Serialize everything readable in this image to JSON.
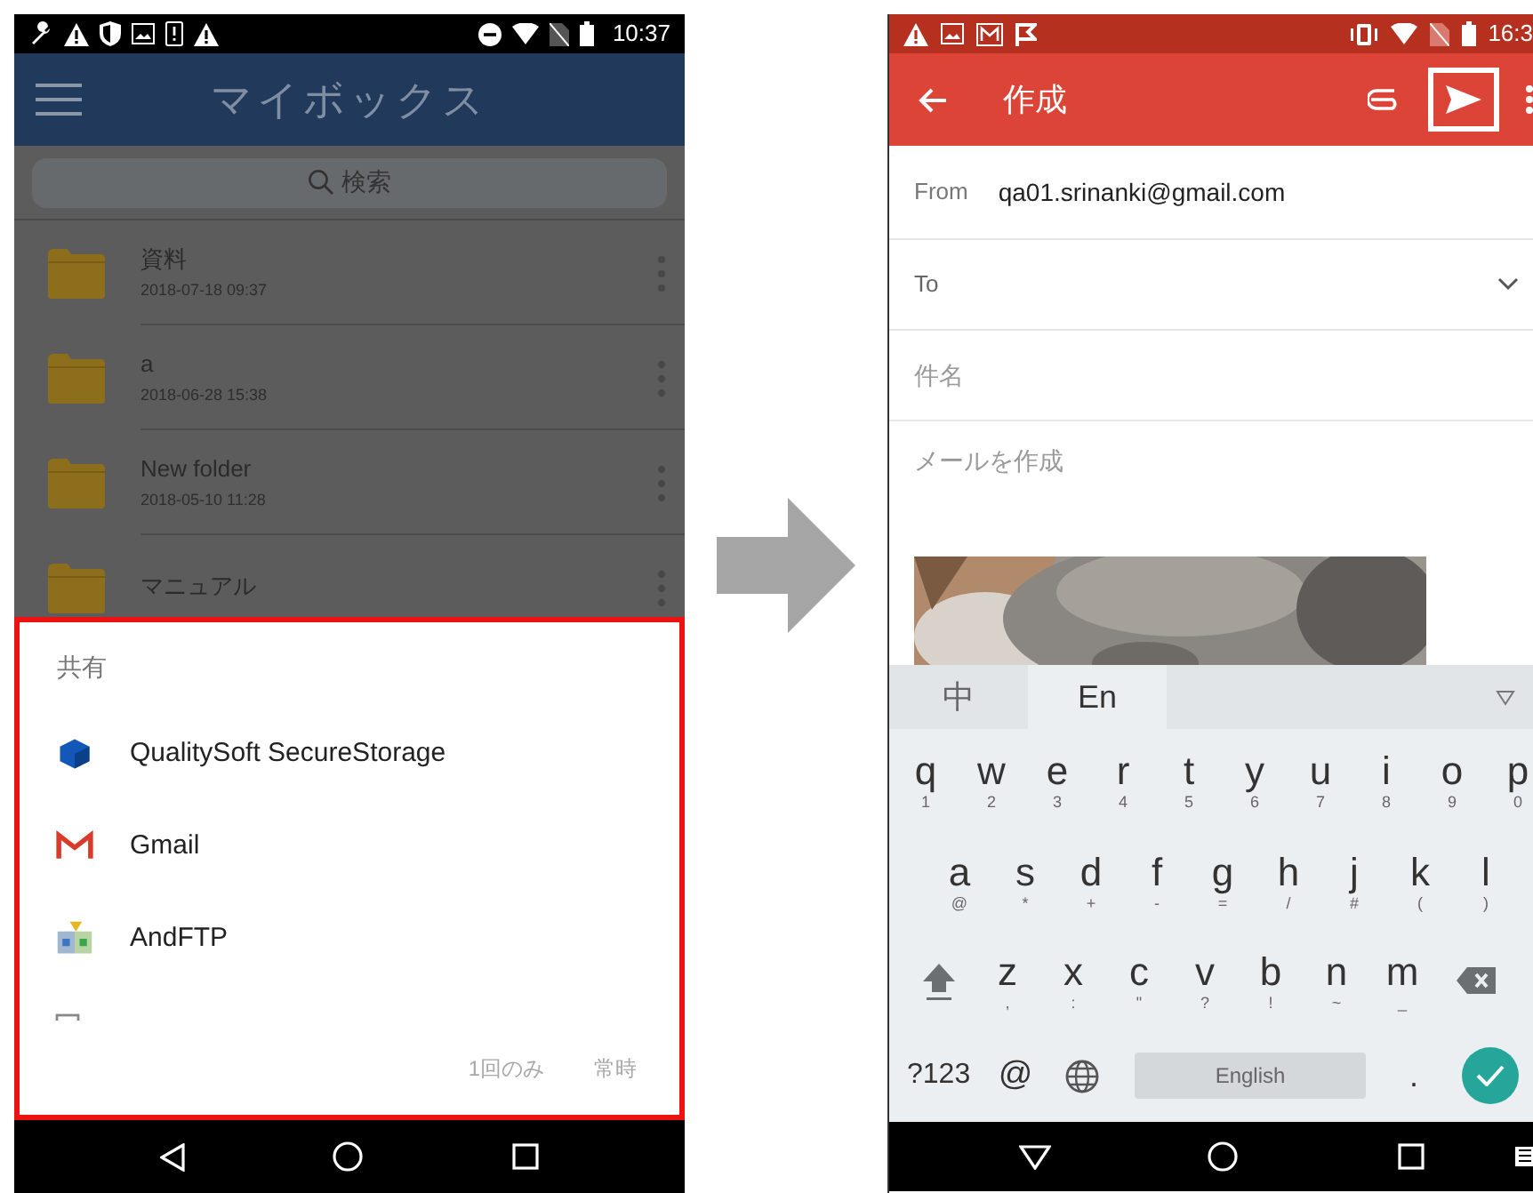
{
  "left_screen": {
    "status_bar": {
      "time": "10:37"
    },
    "app_bar": {
      "title": "マイボックス"
    },
    "search": {
      "placeholder": "検索"
    },
    "folders": [
      {
        "name": "資料",
        "date": "2018-07-18 09:37"
      },
      {
        "name": "a",
        "date": "2018-06-28 15:38"
      },
      {
        "name": "New folder",
        "date": "2018-05-10 11:28"
      },
      {
        "name": "マニュアル"
      }
    ],
    "share_sheet": {
      "title": "共有",
      "highlighted": true,
      "apps": [
        {
          "kind": "storage",
          "name": "QualitySoft SecureStorage"
        },
        {
          "kind": "gmail",
          "name": "Gmail"
        },
        {
          "kind": "ftp",
          "name": "AndFTP"
        },
        {
          "kind": "generic"
        }
      ],
      "actions": [
        {
          "label": "1回のみ",
          "disabled": true
        },
        {
          "label": "常時",
          "disabled": true
        }
      ]
    }
  },
  "right_screen": {
    "status_bar": {
      "time": "16:3"
    },
    "app_bar": {
      "title": "作成",
      "send_highlighted": true
    },
    "from": {
      "label": "From",
      "value": "qa01.srinanki@gmail.com"
    },
    "to": {
      "label": "To"
    },
    "subject": {
      "placeholder": "件名"
    },
    "body": {
      "placeholder": "メールを作成"
    },
    "keyboard": {
      "modes": [
        {
          "label": "中",
          "selected": false
        },
        {
          "label": "En",
          "selected": true
        }
      ],
      "rows": [
        [
          {
            "key": "q",
            "hint": "1"
          },
          {
            "key": "w",
            "hint": "2"
          },
          {
            "key": "e",
            "hint": "3"
          },
          {
            "key": "r",
            "hint": "4"
          },
          {
            "key": "t",
            "hint": "5"
          },
          {
            "key": "y",
            "hint": "6"
          },
          {
            "key": "u",
            "hint": "7"
          },
          {
            "key": "i",
            "hint": "8"
          },
          {
            "key": "o",
            "hint": "9"
          },
          {
            "key": "p",
            "hint": "0"
          }
        ],
        [
          {
            "key": "a",
            "hint": "@"
          },
          {
            "key": "s",
            "hint": "*"
          },
          {
            "key": "d",
            "hint": "+"
          },
          {
            "key": "f",
            "hint": "-"
          },
          {
            "key": "g",
            "hint": "="
          },
          {
            "key": "h",
            "hint": "/"
          },
          {
            "key": "j",
            "hint": "#"
          },
          {
            "key": "k",
            "hint": "("
          },
          {
            "key": "l",
            "hint": ")"
          }
        ],
        [
          {
            "key": "z",
            "hint": ","
          },
          {
            "key": "x",
            "hint": ":"
          },
          {
            "key": "c",
            "hint": "\""
          },
          {
            "key": "v",
            "hint": "?"
          },
          {
            "key": "b",
            "hint": "!"
          },
          {
            "key": "n",
            "hint": "~"
          },
          {
            "key": "m",
            "hint": "_"
          }
        ]
      ],
      "bottom_row": {
        "symbols": "?123",
        "at": "@",
        "space": "English",
        "period": "."
      }
    }
  }
}
